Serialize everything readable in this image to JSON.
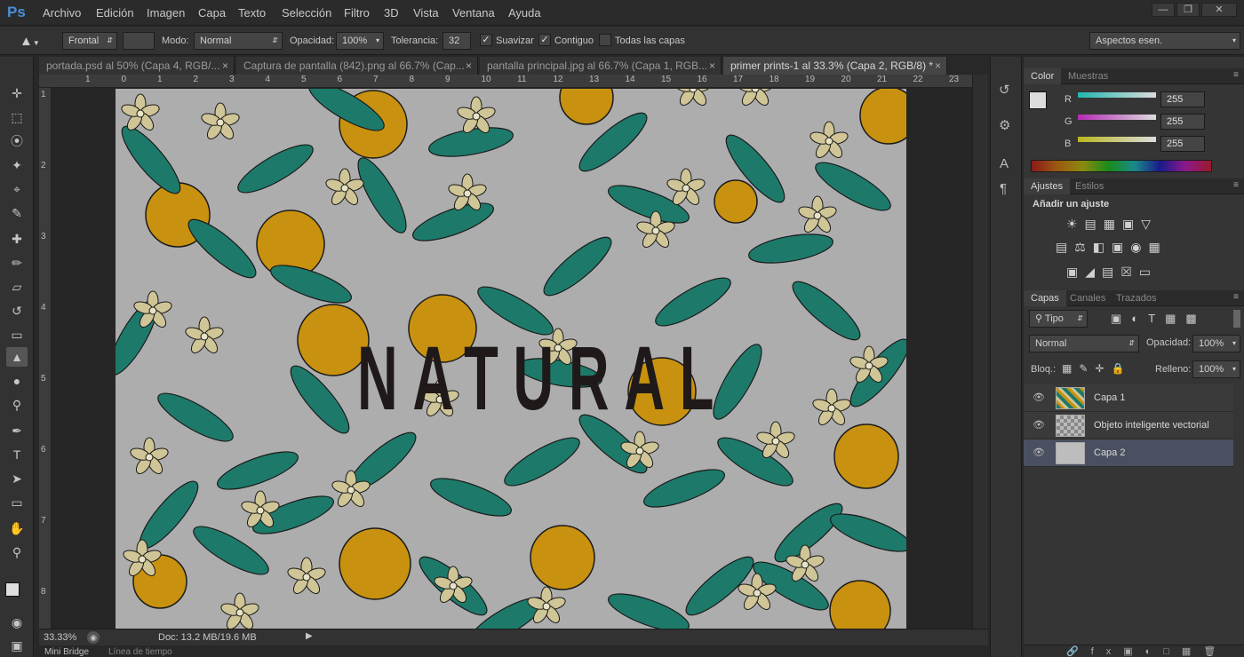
{
  "app": {
    "logo": "Ps"
  },
  "menu": [
    "Archivo",
    "Edición",
    "Imagen",
    "Capa",
    "Texto",
    "Selección",
    "Filtro",
    "3D",
    "Vista",
    "Ventana",
    "Ayuda"
  ],
  "window_controls": {
    "minimize": "—",
    "restore": "❐",
    "close": "✕"
  },
  "options": {
    "tool_icon": "paint-bucket-icon",
    "fill_source": "Frontal",
    "mode_label": "Modo:",
    "mode_value": "Normal",
    "opacity_label": "Opacidad:",
    "opacity_value": "100%",
    "tolerance_label": "Tolerancia:",
    "tolerance_value": "32",
    "antialias_label": "Suavizar",
    "contiguous_label": "Contiguo",
    "all_layers_label": "Todas las capas",
    "workspace": "Aspectos esen."
  },
  "tabs": [
    {
      "label": "portada.psd al 50% (Capa 4, RGB/...",
      "close": "×"
    },
    {
      "label": "Captura de pantalla (842).png al 66.7% (Cap...",
      "close": "×"
    },
    {
      "label": "pantalla principal.jpg al 66.7% (Capa 1, RGB...",
      "close": "×"
    },
    {
      "label": "primer prints-1 al 33.3% (Capa 2, RGB/8) *",
      "close": "×"
    }
  ],
  "ruler_top": [
    "1",
    "0",
    "1",
    "2",
    "3",
    "4",
    "5",
    "6",
    "7",
    "8",
    "9",
    "10",
    "11",
    "12",
    "13",
    "14",
    "15",
    "16",
    "17",
    "18",
    "19",
    "20",
    "21",
    "22",
    "23"
  ],
  "ruler_left": [
    "1",
    "2",
    "3",
    "4",
    "5",
    "6",
    "7",
    "8"
  ],
  "canvas": {
    "title_text": "NATURAL",
    "bg_color": "#adadad",
    "orange": "#c8910f",
    "leaf": "#1d7a6a",
    "flower": "#cfc596"
  },
  "status": {
    "zoom": "33.33%",
    "doc": "Doc: 13.2 MB/19.6 MB"
  },
  "bottom_tabs": [
    "Mini Bridge",
    "Línea de tiempo"
  ],
  "color_panel": {
    "tabs": [
      "Color",
      "Muestras"
    ],
    "channels": [
      {
        "label": "R",
        "value": "255",
        "color": "#20b7b0"
      },
      {
        "label": "G",
        "value": "255",
        "color": "#b42ab4"
      },
      {
        "label": "B",
        "value": "255",
        "color": "#b9b71f"
      }
    ]
  },
  "adjustments_panel": {
    "tabs": [
      "Ajustes",
      "Estilos"
    ],
    "heading": "Añadir un ajuste"
  },
  "layers_panel": {
    "tabs": [
      "Capas",
      "Canales",
      "Trazados"
    ],
    "filter": "Tipo",
    "blend_mode": "Normal",
    "opacity_label": "Opacidad:",
    "opacity_value": "100%",
    "lock_label": "Bloq.:",
    "fill_label": "Relleno:",
    "fill_value": "100%",
    "layers": [
      {
        "name": "Capa 1"
      },
      {
        "name": "Objeto inteligente vectorial"
      },
      {
        "name": "Capa 2"
      }
    ]
  }
}
